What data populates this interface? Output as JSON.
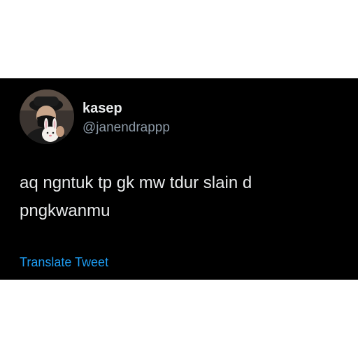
{
  "tweet": {
    "display_name": "kasep",
    "handle": "@janendrappp",
    "text_lines": [
      "aq ngntuk tp gk mw tdur slain d",
      "pngkwanmu"
    ],
    "translate_label": "Translate Tweet",
    "avatar_icon": "profile-photo",
    "colors": {
      "background": "#000000",
      "text": "#e7e9ea",
      "secondary": "#8b98a5",
      "link": "#1d9bf0"
    }
  }
}
